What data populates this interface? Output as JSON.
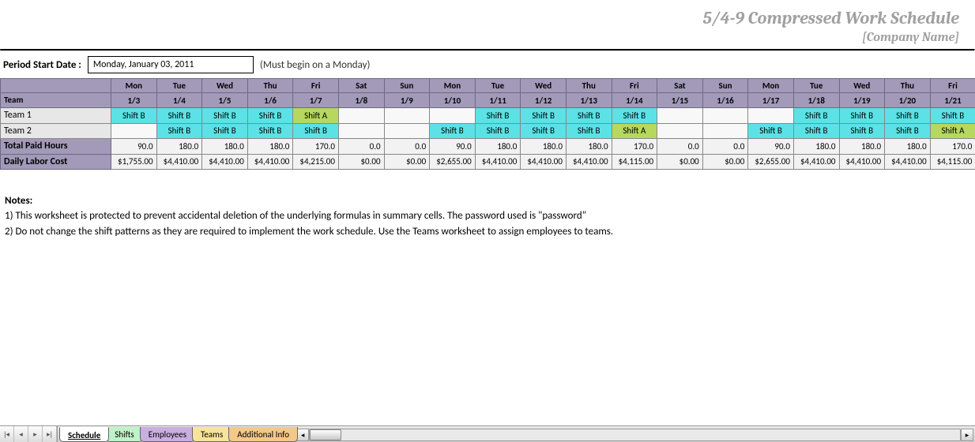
{
  "header": {
    "title": "5/4-9 Compressed Work Schedule",
    "company": "[Company Name]"
  },
  "period": {
    "label": "Period Start Date :",
    "value": "Monday, January 03, 2011",
    "hint": "(Must begin on a Monday)"
  },
  "table": {
    "team_heading": "Team",
    "columns": [
      {
        "dow": "Mon",
        "md": "1/3"
      },
      {
        "dow": "Tue",
        "md": "1/4"
      },
      {
        "dow": "Wed",
        "md": "1/5"
      },
      {
        "dow": "Thu",
        "md": "1/6"
      },
      {
        "dow": "Fri",
        "md": "1/7"
      },
      {
        "dow": "Sat",
        "md": "1/8"
      },
      {
        "dow": "Sun",
        "md": "1/9"
      },
      {
        "dow": "Mon",
        "md": "1/10"
      },
      {
        "dow": "Tue",
        "md": "1/11"
      },
      {
        "dow": "Wed",
        "md": "1/12"
      },
      {
        "dow": "Thu",
        "md": "1/13"
      },
      {
        "dow": "Fri",
        "md": "1/14"
      },
      {
        "dow": "Sat",
        "md": "1/15"
      },
      {
        "dow": "Sun",
        "md": "1/16"
      },
      {
        "dow": "Mon",
        "md": "1/17"
      },
      {
        "dow": "Tue",
        "md": "1/18"
      },
      {
        "dow": "Wed",
        "md": "1/19"
      },
      {
        "dow": "Thu",
        "md": "1/20"
      },
      {
        "dow": "Fri",
        "md": "1/21"
      }
    ],
    "teams": [
      {
        "name": "Team 1",
        "cells": [
          "Shift B",
          "Shift B",
          "Shift B",
          "Shift B",
          "Shift A",
          "",
          "",
          "",
          "Shift B",
          "Shift B",
          "Shift B",
          "Shift B",
          "",
          "",
          "",
          "Shift B",
          "Shift B",
          "Shift B",
          "Shift B"
        ]
      },
      {
        "name": "Team 2",
        "cells": [
          "",
          "Shift B",
          "Shift B",
          "Shift B",
          "Shift B",
          "",
          "",
          "Shift B",
          "Shift B",
          "Shift B",
          "Shift B",
          "Shift A",
          "",
          "",
          "Shift B",
          "Shift B",
          "Shift B",
          "Shift B",
          "Shift A"
        ]
      }
    ],
    "totals": [
      {
        "label": "Total Paid Hours",
        "values": [
          "90.0",
          "180.0",
          "180.0",
          "180.0",
          "170.0",
          "0.0",
          "0.0",
          "90.0",
          "180.0",
          "180.0",
          "180.0",
          "170.0",
          "0.0",
          "0.0",
          "90.0",
          "180.0",
          "180.0",
          "180.0",
          "170.0"
        ]
      },
      {
        "label": "Daily Labor Cost",
        "values": [
          "$1,755.00",
          "$4,410.00",
          "$4,410.00",
          "$4,410.00",
          "$4,215.00",
          "$0.00",
          "$0.00",
          "$2,655.00",
          "$4,410.00",
          "$4,410.00",
          "$4,410.00",
          "$4,115.00",
          "$0.00",
          "$0.00",
          "$2,655.00",
          "$4,410.00",
          "$4,410.00",
          "$4,410.00",
          "$4,115.00"
        ]
      }
    ]
  },
  "notes": {
    "heading": "Notes:",
    "lines": [
      "1) This worksheet is protected to prevent accidental deletion of the underlying formulas in summary cells. The password used is \"password\"",
      "2) Do not change the shift patterns as they are required to implement the work schedule.  Use the Teams worksheet to assign employees to teams."
    ]
  },
  "sheets": {
    "tabs": [
      {
        "label": "Schedule",
        "key": "schedule",
        "active": true
      },
      {
        "label": "Shifts",
        "key": "shifts"
      },
      {
        "label": "Employees",
        "key": "employees"
      },
      {
        "label": "Teams",
        "key": "teams"
      },
      {
        "label": "Additional Info",
        "key": "addl"
      }
    ]
  },
  "shift_colors": {
    "Shift A": "shift-a",
    "Shift B": "shift-b"
  }
}
